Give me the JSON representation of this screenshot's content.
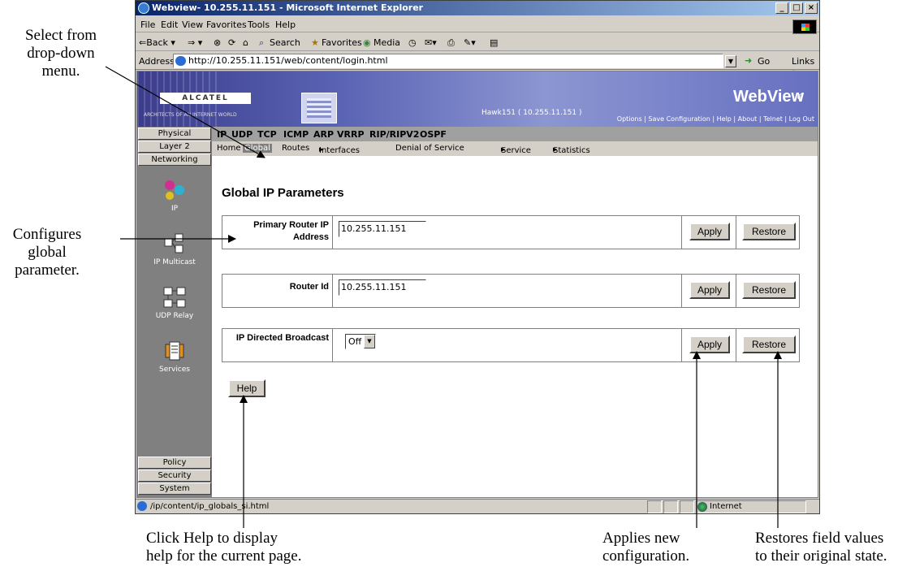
{
  "callouts": {
    "select_from_menu": [
      "Select from",
      "drop-down",
      "menu."
    ],
    "configures": [
      "Configures",
      "global",
      "parameter."
    ],
    "click_help": [
      "Click Help to display",
      "help for the current page."
    ],
    "applies": [
      "Applies new",
      "configuration."
    ],
    "restores": [
      "Restores field values",
      "to their original state."
    ]
  },
  "window": {
    "title": "Webview- 10.255.11.151 - Microsoft Internet Explorer",
    "menu": [
      "File",
      "Edit",
      "View",
      "Favorites",
      "Tools",
      "Help"
    ],
    "toolbar": [
      "⇐Back ▾",
      "⇒ ▾",
      "⊗",
      "⟳",
      "⌂",
      "Search",
      "Favorites",
      "Media"
    ],
    "address_label": "Address",
    "address": "http://10.255.11.151/web/content/login.html",
    "go": "Go",
    "links": "Links »",
    "status_text": "/ip/content/ip_globals_si.html",
    "zone": "Internet"
  },
  "header": {
    "logo": "ALCATEL",
    "tagline": "ARCHITECTS OF AN INTERNET WORLD",
    "hostname": "Hawk151 ( 10.255.11.151 )",
    "brand": "WebView",
    "links": "Options | Save Configuration | Help | About | Telnet | Log Out"
  },
  "sidebar": {
    "top_tabs": [
      "Physical",
      "Layer 2",
      "Networking"
    ],
    "icons": [
      "IP",
      "IP Multicast",
      "UDP Relay",
      "Services"
    ],
    "bottom_tabs": [
      "Policy",
      "Security",
      "System"
    ]
  },
  "nav": {
    "tabs": [
      "IP",
      "UDP",
      "TCP",
      "ICMP",
      "ARP",
      "VRRP",
      "RIP/RIPV2",
      "OSPF"
    ],
    "sub": [
      "Home",
      "Global",
      "Routes",
      "Interfaces",
      "Denial of Service",
      "Service",
      "Statistics"
    ]
  },
  "main": {
    "title": "Global IP Parameters",
    "rows": [
      {
        "label": "Primary Router IP Address",
        "value": "10.255.11.151"
      },
      {
        "label": "Router Id",
        "value": "10.255.11.151"
      },
      {
        "label": "IP Directed Broadcast",
        "value": "Off"
      }
    ],
    "apply": "Apply",
    "restore": "Restore",
    "help": "Help"
  }
}
